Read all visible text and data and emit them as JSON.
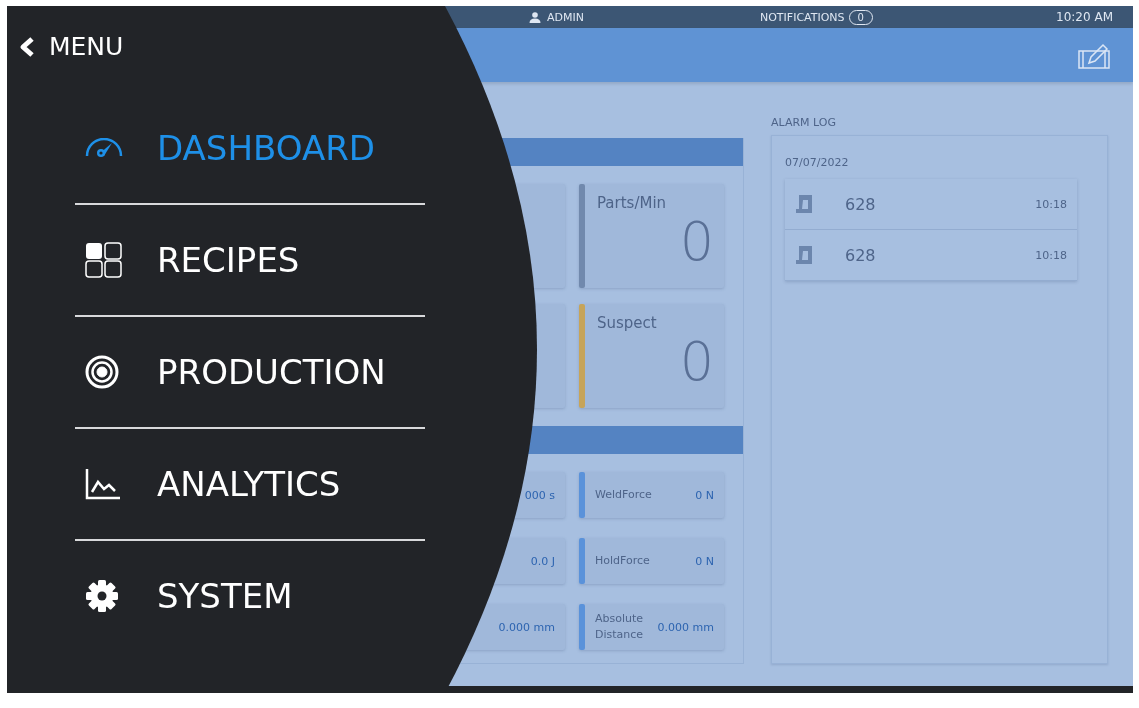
{
  "status_bar": {
    "user": "ADMIN",
    "notifications_label": "NOTIFICATIONS",
    "notifications_count": "0",
    "time": "10:20 AM"
  },
  "menu": {
    "title": "MENU",
    "items": [
      {
        "label": "DASHBOARD",
        "kind": "gauge",
        "selected": true
      },
      {
        "label": "RECIPES",
        "kind": "tiles",
        "selected": false
      },
      {
        "label": "PRODUCTION",
        "kind": "target",
        "selected": false
      },
      {
        "label": "ANALYTICS",
        "kind": "chart",
        "selected": false
      },
      {
        "label": "SYSTEM",
        "kind": "gear",
        "selected": false
      }
    ]
  },
  "counters": [
    {
      "label": "Parts/Min",
      "value": "0",
      "color": "#7189ad"
    },
    {
      "label": "Suspect",
      "value": "0",
      "color": "#c6a45a"
    }
  ],
  "parameters": [
    {
      "left_value": "000 s",
      "label": "WeldForce",
      "value": "0 N"
    },
    {
      "left_value": "0.0 J",
      "label": "HoldForce",
      "value": "0 N"
    },
    {
      "left_value": "0.000 mm",
      "label": "Absolute Distance",
      "value": "0.000 mm"
    }
  ],
  "alarm_log": {
    "title": "ALARM LOG",
    "date": "07/07/2022",
    "entries": [
      {
        "code": "628",
        "time": "10:18"
      },
      {
        "code": "628",
        "time": "10:18"
      }
    ]
  }
}
